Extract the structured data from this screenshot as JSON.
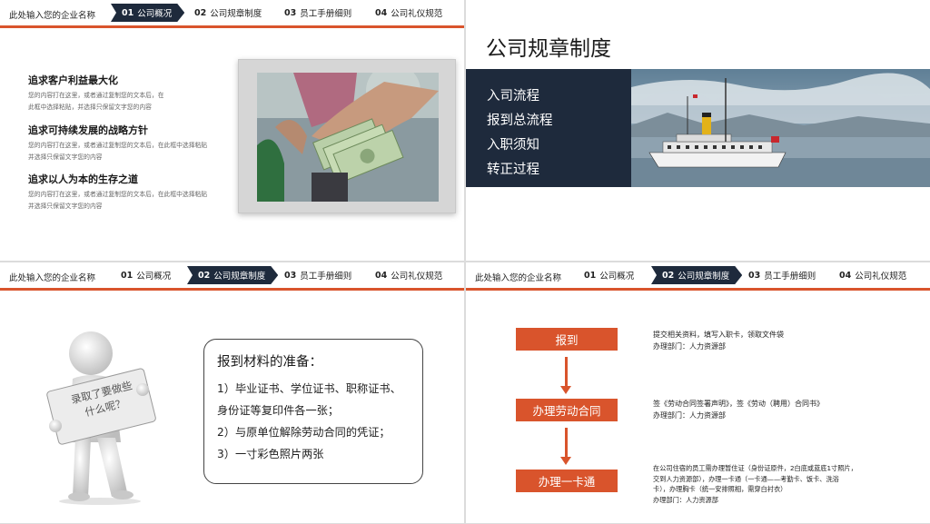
{
  "header": {
    "company": "此处输入您的企业名称",
    "nav": [
      {
        "num": "01",
        "label": "公司概况"
      },
      {
        "num": "02",
        "label": "公司规章制度"
      },
      {
        "num": "03",
        "label": "员工手册细则"
      },
      {
        "num": "04",
        "label": "公司礼仪规范"
      }
    ]
  },
  "slide1": {
    "items": [
      {
        "title": "追求客户利益最大化",
        "line1": "您的内容打在这里，或者通过复制您的文本后，在",
        "line2": "此框中选择粘贴，并选择只保留文字您的内容"
      },
      {
        "title": "追求可持续发展的战略方针",
        "line1": "您的内容打在这里，或者通过复制您的文本后，在此框中选择粘贴",
        "line2": "并选择只保留文字您的内容"
      },
      {
        "title": "追求以人为本的生存之道",
        "line1": "您的内容打在这里，或者通过复制您的文本后，在此框中选择粘贴",
        "line2": "并选择只保留文字您的内容"
      }
    ]
  },
  "slide2": {
    "title": "公司规章制度",
    "list": [
      "入司流程",
      "报到总流程",
      "入职须知",
      "转正过程"
    ]
  },
  "slide3": {
    "sign_line1": "录取了要做些",
    "sign_line2": "什么呢？",
    "heading": "报到材料的准备：",
    "lines": [
      "1）毕业证书、学位证书、职称证书、",
      "身份证等复印件各一张；",
      "2）与原单位解除劳动合同的凭证；",
      "3）一寸彩色照片两张"
    ]
  },
  "slide4": {
    "steps": [
      {
        "label": "报到",
        "desc1": "提交相关资料，填写入职卡，领取文件袋",
        "desc2": "办理部门：人力资源部"
      },
      {
        "label": "办理劳动合同",
        "desc1": "签《劳动合同签署声明》，签《劳动（聘用）合同书》",
        "desc2": "办理部门：人力资源部"
      },
      {
        "label": "办理一卡通",
        "desc_lines": [
          "在公司住宿的员工需办理暂住证（身份证原件，2白底或蓝底1寸照片，",
          "交到人力资源部），办理一卡通（一卡通——考勤卡、饭卡、洗浴",
          "卡），办理胸卡（统一安排照相，需穿白衬衣）",
          "办理部门：人力资源部"
        ]
      }
    ]
  },
  "colors": {
    "accent": "#d9542c",
    "navy": "#1e2a3c"
  }
}
